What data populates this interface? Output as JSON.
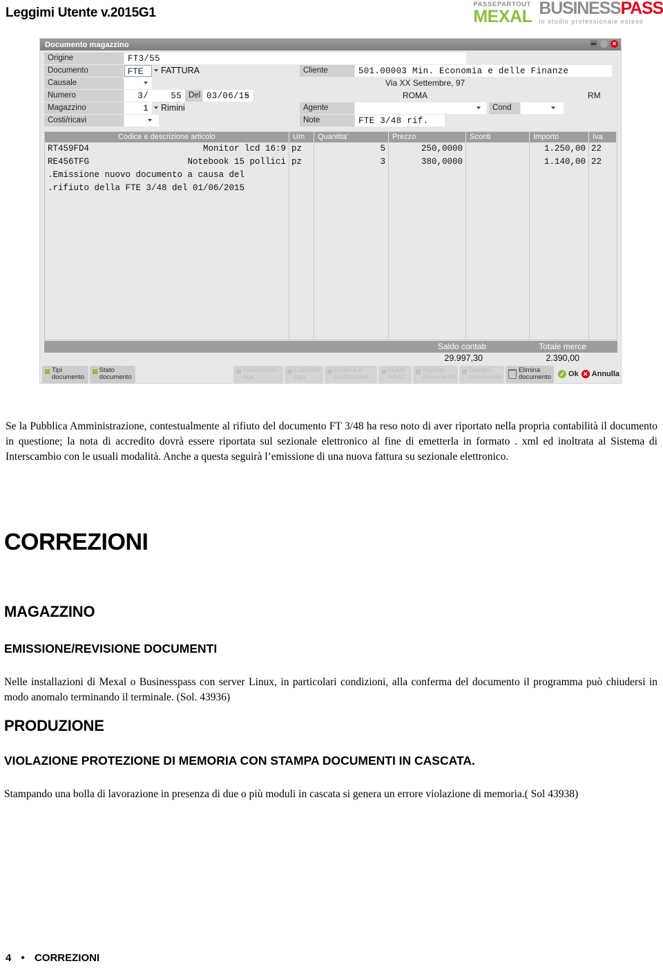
{
  "header": {
    "doc_title": "Leggimi Utente v.2015G1",
    "logo": {
      "passepartout": "PASSEPARTOUT",
      "mexal": "MEXAL",
      "business": "BUSINESS",
      "pass": "PASS",
      "tagline": "lo studio professionale esteso"
    }
  },
  "screenshot": {
    "window_title": "Documento magazzino",
    "window_buttons": [
      "pin-icon",
      "minimize-icon",
      "close-icon"
    ],
    "form": {
      "origine_label": "Origine",
      "origine_value": "FT3/55",
      "documento_label": "Documento",
      "documento_code": "FTE",
      "documento_desc": "FATTURA",
      "cliente_label": "Cliente",
      "cliente_value": "501.00003 Min. Economia e delle Finanze",
      "cliente_addr": "Via XX Settembre, 97",
      "cliente_city": "ROMA",
      "cliente_prov": "RM",
      "causale_label": "Causale",
      "causale_value": "",
      "numero_label": "Numero",
      "numero_serie": "3/",
      "numero_value": "55",
      "del_label": "Del",
      "data_value": "03/06/15",
      "magazzino_label": "Magazzino",
      "magazzino_num": "1",
      "magazzino_desc": "Rimini",
      "agente_label": "Agente",
      "agente_value": "",
      "cond_label": "Cond",
      "cond_value": "",
      "costiricavi_label": "Costi/ricavi",
      "costiricavi_value": "",
      "note_label": "Note",
      "note_value": "FTE 3/48 rif."
    },
    "table": {
      "columns": [
        "Codice e descrizione articolo",
        "Um",
        "Quantita'",
        "Prezzo",
        "Sconti",
        "Importo",
        "Iva"
      ],
      "rows": [
        {
          "codice": "RT459FD4",
          "descrizione": "Monitor lcd 16:9",
          "um": "pz",
          "quantita": "5",
          "prezzo": "250,0000",
          "sconti": "",
          "importo": "1.250,00",
          "iva": "22"
        },
        {
          "codice": "RE456TFG",
          "descrizione": "Notebook 15 pollici",
          "um": "pz",
          "quantita": "3",
          "prezzo": "380,0000",
          "sconti": "",
          "importo": "1.140,00",
          "iva": "22"
        }
      ],
      "note_lines": [
        ".Emissione nuovo documento a causa del",
        ".rifiuto della FTE 3/48 del 01/06/2015"
      ]
    },
    "totals": {
      "saldo_label": "Saldo contab",
      "saldo_value": "29.997,30",
      "totale_label": "Totale merce",
      "totale_value": "2.390,00"
    },
    "buttons": [
      {
        "line1": "Tipi",
        "line2": "documento",
        "enabled": true
      },
      {
        "line1": "Stato",
        "line2": "documento",
        "enabled": true
      },
      {
        "line1": "Inserimento",
        "line2": "riga",
        "enabled": false
      },
      {
        "line1": "Cancella",
        "line2": "riga",
        "enabled": false
      },
      {
        "line1": "Ricerca e",
        "line2": "sostituzione",
        "enabled": false
      },
      {
        "line1": "Evadi",
        "line2": "Art.62",
        "enabled": false
      },
      {
        "line1": "Importa",
        "line2": "documento",
        "enabled": false
      },
      {
        "line1": "Stampa",
        "line2": "documento",
        "enabled": false
      },
      {
        "line1": "Elimina",
        "line2": "documento",
        "enabled": true
      }
    ],
    "ok_label": "Ok",
    "cancel_label": "Annulla"
  },
  "content": {
    "intro_paragraph": "Se la Pubblica Amministrazione, contestualmente al rifiuto del documento FT 3/48  ha reso noto di aver riportato nella propria contabilità il documento in questione; la  nota di accredito dovrà essere riportata sul sezionale elettronico al fine di emetterla in formato . xml ed inoltrata al Sistema di Interscambio con le usuali modalità. Anche a questa seguirà l’emissione di una nuova fattura su sezionale elettronico.",
    "heading_correzioni": "CORREZIONI",
    "heading_magazzino": "MAGAZZINO",
    "heading_emissione": "EMISSIONE/REVISIONE DOCUMENTI",
    "paragraph_emissione": "Nelle installazioni di Mexal o Businesspass con server Linux, in particolari condizioni, alla conferma del documento il programma può chiudersi in modo anomalo terminando il terminale. (Sol. 43936)",
    "heading_produzione": "PRODUZIONE",
    "heading_violazione": "VIOLAZIONE PROTEZIONE DI MEMORIA CON STAMPA DOCUMENTI IN CASCATA.",
    "paragraph_violazione": "Stampando una bolla di lavorazione in presenza di due o più moduli in cascata si genera un errore violazione di memoria.( Sol 43938)"
  },
  "footer": {
    "page_number": "4",
    "separator": "•",
    "section": "CORREZIONI"
  },
  "colors": {
    "accent_green": "#8cbf3f",
    "accent_red": "#e2001a",
    "titlebar_gray": "#8b8b8b",
    "header_gray": "#9d9d9d"
  }
}
